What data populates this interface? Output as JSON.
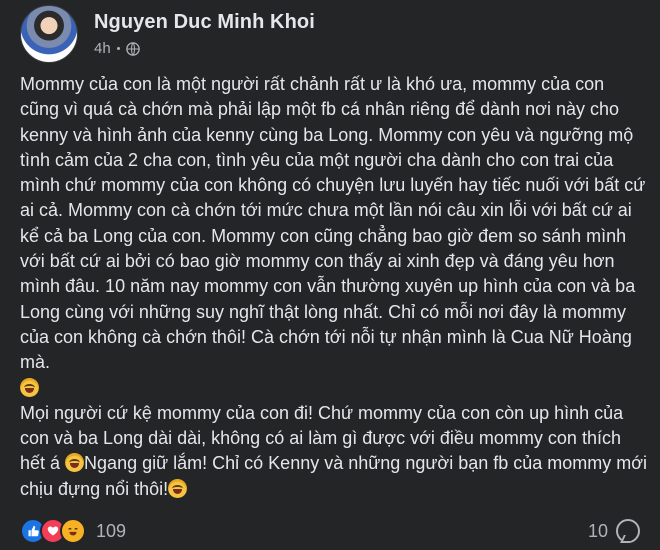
{
  "post": {
    "author_name": "Nguyen Duc Minh Khoi",
    "time": "4h",
    "privacy_icon": "globe-icon",
    "paragraph_1": "Mommy của con là một người rất chảnh rất ư là khó ưa, mommy của con cũng vì quá cà chớn mà phải lập một fb cá nhân riêng để dành nơi này cho kenny và hình ảnh của kenny cùng ba Long. Mommy con yêu và ngưỡng mộ tình cảm của 2 cha con, tình yêu của một người cha dành cho con trai của mình chứ mommy của con không có chuyện lưu luyến hay tiếc nuối với bất cứ ai cả. Mommy con cà chớn tới mức chưa một lần nói câu xin lỗi với bất cứ ai kể cả ba Long của con. Mommy con cũng chẳng bao giờ đem so sánh mình với bất cứ ai bởi có bao giờ mommy con thấy ai xinh đẹp và đáng yêu hơn mình đâu. 10 năm nay mommy con vẫn thường xuyên up hình của con và ba Long cùng với những suy nghĩ thật lòng nhất. Chỉ có mỗi nơi đây là mommy của con không cà chớn thôi! Cà chớn tới nỗi tự nhận mình là Cua Nữ Hoàng mà.",
    "paragraph_2_a": "Mọi người cứ kệ mommy của con đi! Chứ mommy của con còn up hình của con và ba Long dài dài, không có ai làm gì được với điều mommy con thích hết á ",
    "paragraph_2_b": "Ngang giữ lắm! Chỉ có Kenny và những người bạn fb của mommy mới chịu đựng nổi thôi!",
    "emoji": "laughing-emoji"
  },
  "footer": {
    "reaction_icons": [
      "like-icon",
      "love-icon",
      "haha-icon"
    ],
    "reaction_count": "109",
    "comment_count": "10",
    "comment_icon": "comment-icon"
  },
  "colors": {
    "background": "#242526",
    "text": "#e4e6eb",
    "secondary_text": "#b0b3b8",
    "like": "#1b74e4",
    "love": "#f33e58",
    "haha": "#f7b125"
  }
}
